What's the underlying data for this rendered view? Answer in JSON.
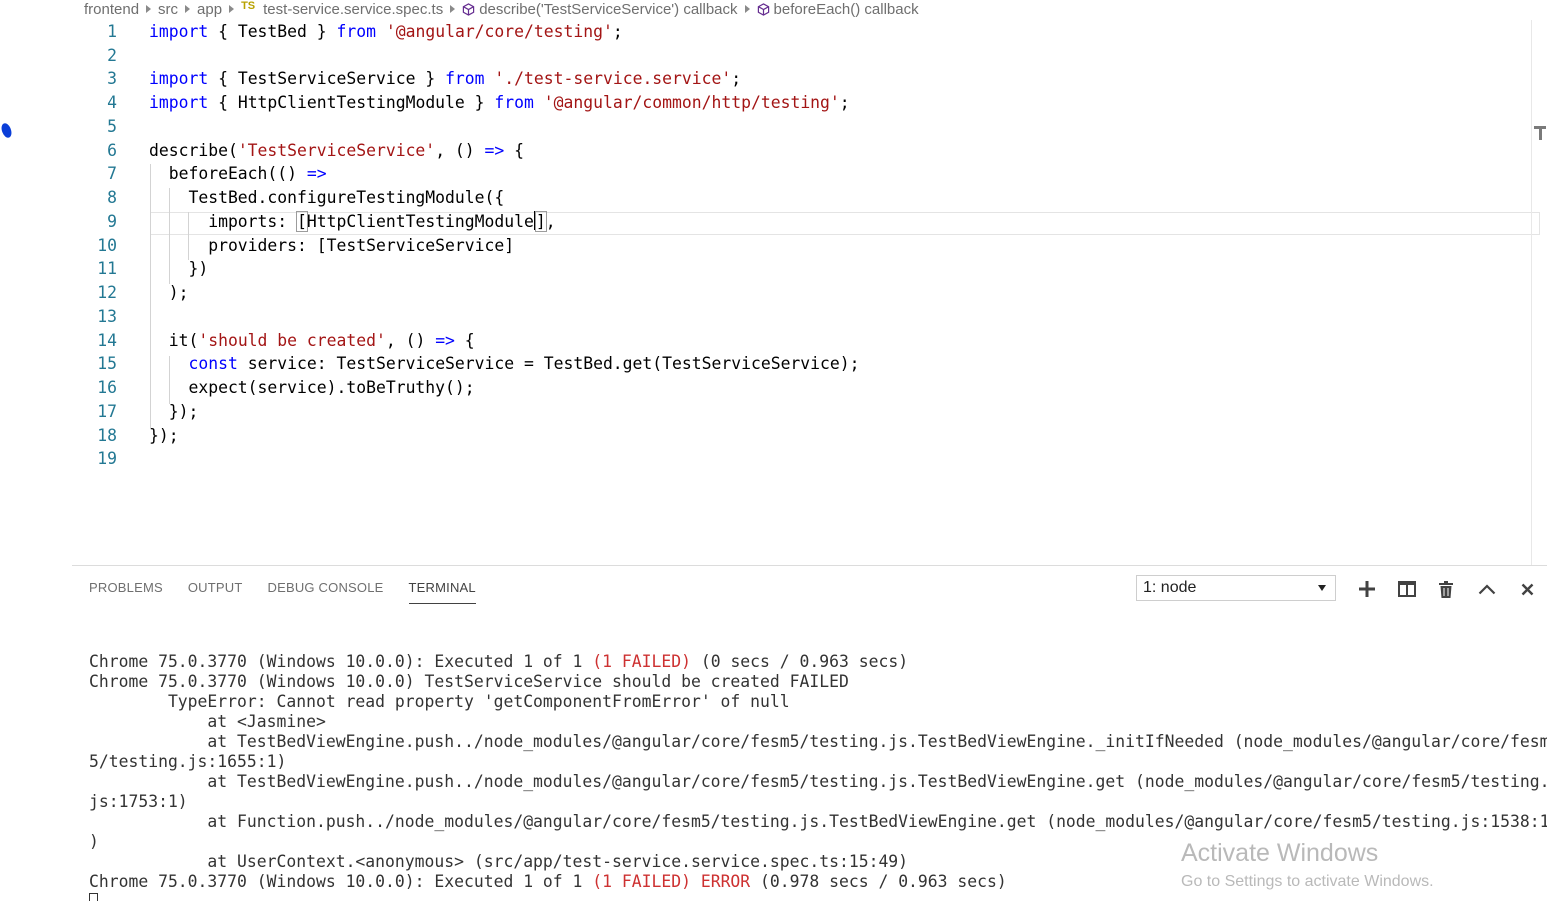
{
  "breadcrumb": {
    "items": [
      "frontend",
      "src",
      "app"
    ],
    "file_badge": "TS",
    "file": "test-service.service.spec.ts",
    "symbols": [
      "describe('TestServiceService') callback",
      "beforeEach() callback"
    ]
  },
  "editor": {
    "line_numbers": [
      "1",
      "2",
      "3",
      "4",
      "5",
      "6",
      "7",
      "8",
      "9",
      "10",
      "11",
      "12",
      "13",
      "14",
      "15",
      "16",
      "17",
      "18",
      "19"
    ],
    "l1": {
      "kw1": "import",
      "t1": " { TestBed } ",
      "kw2": "from",
      "t2": " ",
      "s1": "'@angular/core/testing'",
      "t3": ";"
    },
    "l3": {
      "kw1": "import",
      "t1": " { TestServiceService } ",
      "kw2": "from",
      "t2": " ",
      "s1": "'./test-service.service'",
      "t3": ";"
    },
    "l4": {
      "kw1": "import",
      "t1": " { HttpClientTestingModule } ",
      "kw2": "from",
      "t2": " ",
      "s1": "'@angular/common/http/testing'",
      "t3": ";"
    },
    "l6": {
      "t1": "describe(",
      "s1": "'TestServiceService'",
      "t2": ", () ",
      "kw1": "=>",
      "t3": " {"
    },
    "l7": {
      "t1": "  beforeEach(() ",
      "kw1": "=>"
    },
    "l8": {
      "t1": "    TestBed.configureTestingModule({"
    },
    "l9": {
      "t1": "      imports: ",
      "b1": "[",
      "t2": "HttpClientTestingModule",
      "b2": "]",
      "t3": ","
    },
    "l10": {
      "t1": "      providers: [TestServiceService]"
    },
    "l11": {
      "t1": "    })"
    },
    "l12": {
      "t1": "  );"
    },
    "l14": {
      "t1": "  it(",
      "s1": "'should be created'",
      "t2": ", () ",
      "kw1": "=>",
      "t3": " {"
    },
    "l15": {
      "t0": "    ",
      "kw1": "const",
      "t1": " service: TestServiceService = TestBed.get(TestServiceService);"
    },
    "l16": {
      "t1": "    expect(service).toBeTruthy();"
    },
    "l17": {
      "t1": "  });"
    },
    "l18": {
      "t1": "});"
    }
  },
  "panel": {
    "tabs": [
      "PROBLEMS",
      "OUTPUT",
      "DEBUG CONSOLE",
      "TERMINAL"
    ],
    "active_tab": "TERMINAL",
    "terminal_select": "1: node",
    "buttons": [
      "plus-icon",
      "split-icon",
      "trash-icon",
      "chevron-up-icon",
      "close-icon"
    ]
  },
  "terminal": {
    "l1a": "Chrome 75.0.3770 (Windows 10.0.0): Executed 1 of 1 ",
    "l1b": "(1 FAILED)",
    "l1c": " (0 secs / 0.963 secs)",
    "l2": "Chrome 75.0.3770 (Windows 10.0.0) TestServiceService should be created FAILED",
    "l3": "        TypeError: Cannot read property 'getComponentFromError' of null",
    "l4": "            at <Jasmine>",
    "l5": "            at TestBedViewEngine.push../node_modules/@angular/core/fesm5/testing.js.TestBedViewEngine._initIfNeeded (node_modules/@angular/core/fesm",
    "l6": "5/testing.js:1655:1)",
    "l7": "            at TestBedViewEngine.push../node_modules/@angular/core/fesm5/testing.js.TestBedViewEngine.get (node_modules/@angular/core/fesm5/testing.",
    "l8": "js:1753:1)",
    "l9": "            at Function.push../node_modules/@angular/core/fesm5/testing.js.TestBedViewEngine.get (node_modules/@angular/core/fesm5/testing.js:1538:1",
    "l10": ")",
    "l11": "            at UserContext.<anonymous> (src/app/test-service.service.spec.ts:15:49)",
    "l12a": "Chrome 75.0.3770 (Windows 10.0.0): Executed 1 of 1 ",
    "l12b": "(1 FAILED) ERROR",
    "l12c": " (0.978 secs / 0.963 secs)"
  },
  "watermark": {
    "title": "Activate Windows",
    "subtitle": "Go to Settings to activate Windows."
  },
  "colors": {
    "keyword": "#0000ff",
    "string": "#a31515",
    "line_number": "#237893",
    "error": "#cd3131"
  }
}
